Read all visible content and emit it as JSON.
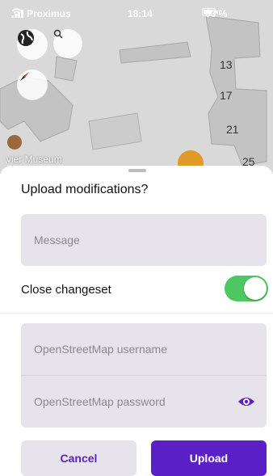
{
  "status_bar": {
    "carrier": "Proximus",
    "time": "18:14",
    "battery": "63 %",
    "icons": [
      "signal-icon",
      "wifi-icon",
      "location-icon",
      "battery-icon"
    ]
  },
  "map": {
    "labels": [
      "13",
      "17",
      "21",
      "25"
    ],
    "poi_label": "vier Museum",
    "buttons": [
      "globe-icon",
      "search-icon",
      "compass-icon"
    ]
  },
  "sheet": {
    "title": "Upload modifications?",
    "message_placeholder": "Message",
    "close_changeset_label": "Close changeset",
    "close_changeset_on": true,
    "username_placeholder": "OpenStreetMap username",
    "password_placeholder": "OpenStreetMap password",
    "cancel_label": "Cancel",
    "upload_label": "Upload"
  },
  "colors": {
    "accent": "#5a20c8",
    "toggle_on": "#4cc761",
    "field_bg": "#e6e4ea"
  }
}
